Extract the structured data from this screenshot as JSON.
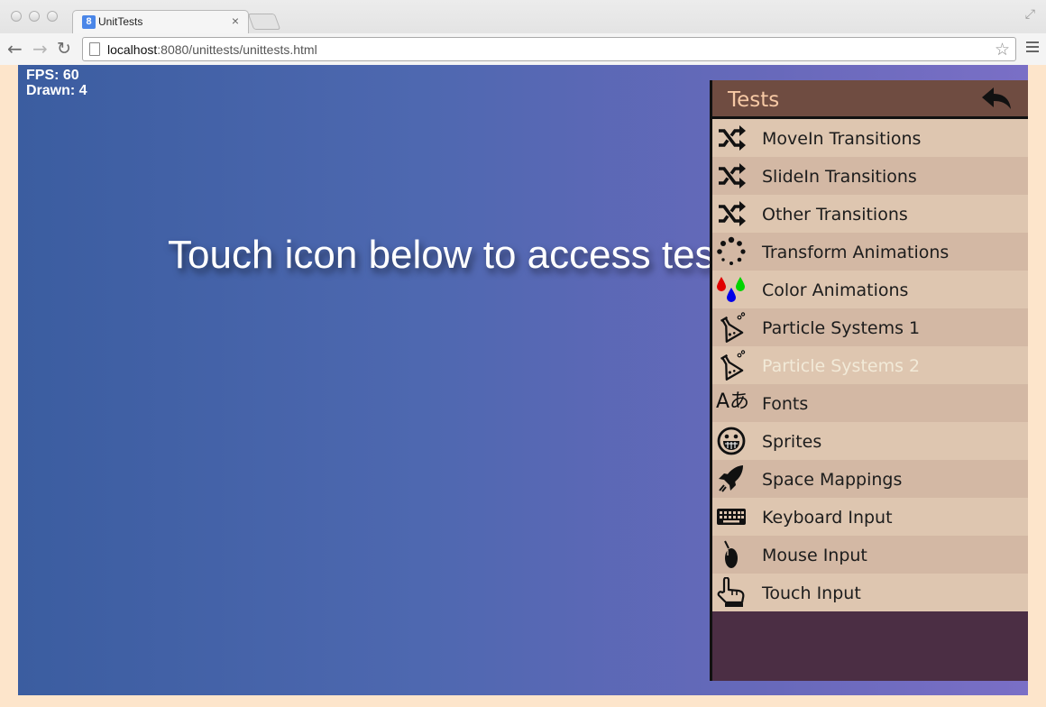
{
  "browser": {
    "tab_title": "UnitTests",
    "tab_close": "×",
    "favicon": "8",
    "url_host": "localhost",
    "url_path": ":8080/unittests/unittests.html"
  },
  "stats": {
    "fps": "FPS: 60",
    "drawn": "Drawn: 4"
  },
  "canvas": {
    "headline": "Touch icon below to access tests"
  },
  "menu": {
    "title": "Tests",
    "back_icon": "reply-arrow-icon",
    "items": [
      {
        "label": "MoveIn Transitions",
        "icon": "shuffle-icon"
      },
      {
        "label": "SlideIn Transitions",
        "icon": "shuffle-icon"
      },
      {
        "label": "Other Transitions",
        "icon": "shuffle-icon"
      },
      {
        "label": "Transform Animations",
        "icon": "spinner-icon"
      },
      {
        "label": "Color Animations",
        "icon": "color-drops-icon"
      },
      {
        "label": "Particle Systems 1",
        "icon": "flask-icon"
      },
      {
        "label": "Particle Systems 2",
        "icon": "flask-icon",
        "state": "disabled"
      },
      {
        "label": "Fonts",
        "icon": "font-glyph-icon"
      },
      {
        "label": "Sprites",
        "icon": "grin-face-icon"
      },
      {
        "label": "Space Mappings",
        "icon": "rocket-icon"
      },
      {
        "label": "Keyboard Input",
        "icon": "keyboard-icon"
      },
      {
        "label": "Mouse Input",
        "icon": "mouse-icon"
      },
      {
        "label": "Touch Input",
        "icon": "pointing-hand-icon"
      }
    ],
    "colors": {
      "header": "#6f4c41",
      "title": "#f7c9a5",
      "row_light": "#dec6b0",
      "row_dark": "#d3b8a4",
      "panel_bottom": "#4b2e44"
    }
  },
  "glyphs": {
    "font_icon": "Aあ",
    "grin_icon": "☺"
  }
}
